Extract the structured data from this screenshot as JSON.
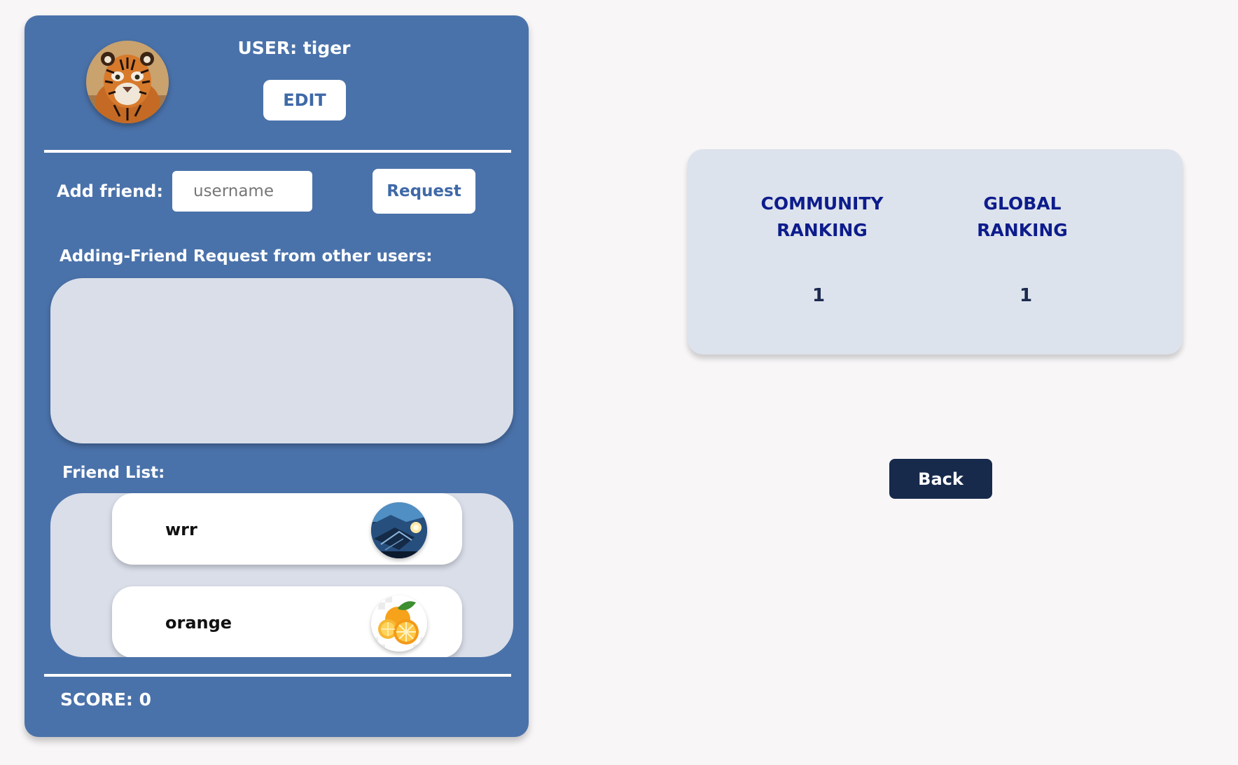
{
  "profile": {
    "user_label": "USER: tiger",
    "avatar_icon": "tiger-avatar",
    "edit_label": "EDIT"
  },
  "add_friend": {
    "label": "Add friend:",
    "input_placeholder": "username",
    "input_value": "",
    "request_label": "Request"
  },
  "friend_requests": {
    "label": "Adding-Friend Request from other users:",
    "items": []
  },
  "friend_list": {
    "label": "Friend List:",
    "items": [
      {
        "name": "wrr",
        "avatar_icon": "dark-landscape-avatar"
      },
      {
        "name": "orange",
        "avatar_icon": "orange-fruit-avatar"
      }
    ]
  },
  "score_label": "SCORE: 0",
  "ranking": {
    "community_line1": "COMMUNITY",
    "community_line2": "RANKING",
    "global_line1": "GLOBAL",
    "global_line2": "RANKING",
    "community_value": "1",
    "global_value": "1"
  },
  "back_label": "Back",
  "colors": {
    "panel": "#4a72aa",
    "page_background": "#f8f6f7",
    "box_fill": "#d9dee9",
    "ranking_heading": "#0d1c8c",
    "back_button": "#172a4c"
  }
}
